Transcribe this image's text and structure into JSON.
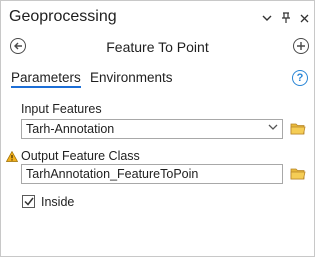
{
  "window": {
    "title": "Geoprocessing",
    "menu_icon": "chevron-down-icon",
    "pin_icon": "pin-icon",
    "close_icon": "close-icon"
  },
  "tool": {
    "title": "Feature To Point",
    "back_icon": "back-arrow-icon",
    "add_icon": "add-icon"
  },
  "tabs": [
    {
      "label": "Parameters",
      "active": true
    },
    {
      "label": "Environments",
      "active": false
    }
  ],
  "help_label": "?",
  "params": {
    "input_features": {
      "label": "Input Features",
      "value": "Tarh-Annotation"
    },
    "output_feature_class": {
      "label": "Output Feature Class",
      "value": "TarhAnnotation_FeatureToPoin",
      "warning": true
    },
    "inside": {
      "label": "Inside",
      "checked": true
    }
  },
  "colors": {
    "accent": "#1c6ed6",
    "folder": "#e8b93a",
    "warning": "#f2b01e"
  }
}
